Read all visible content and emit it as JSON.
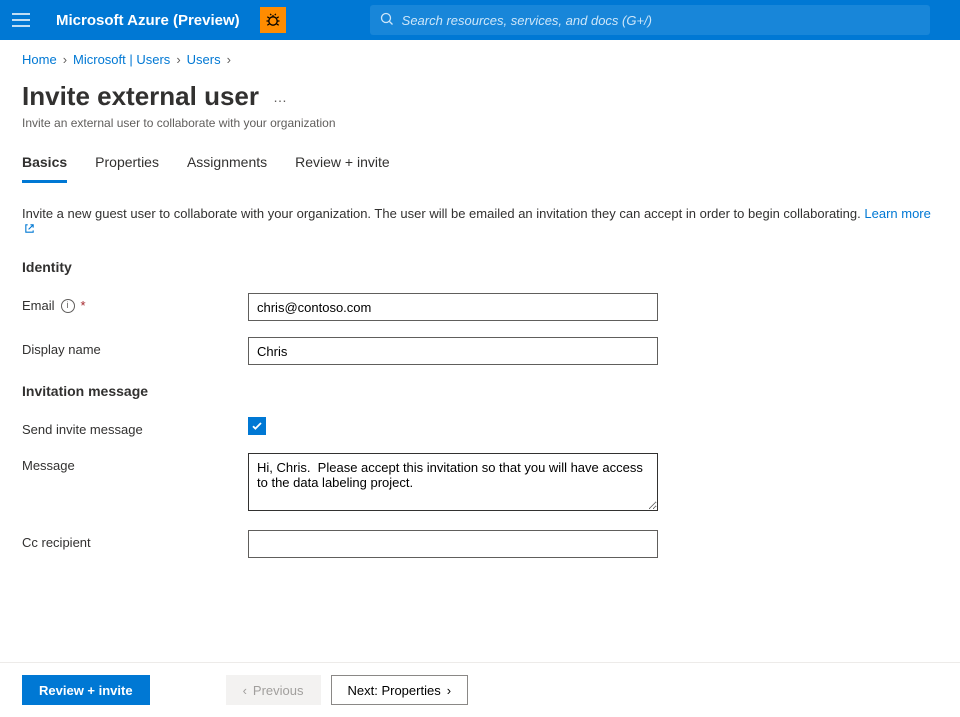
{
  "header": {
    "brand": "Microsoft Azure (Preview)",
    "search_placeholder": "Search resources, services, and docs (G+/)"
  },
  "breadcrumb": {
    "items": [
      "Home",
      "Microsoft | Users",
      "Users"
    ]
  },
  "page": {
    "title": "Invite external user",
    "subtitle": "Invite an external user to collaborate with your organization"
  },
  "tabs": [
    {
      "label": "Basics",
      "active": true
    },
    {
      "label": "Properties",
      "active": false
    },
    {
      "label": "Assignments",
      "active": false
    },
    {
      "label": "Review + invite",
      "active": false
    }
  ],
  "description": {
    "text": "Invite a new guest user to collaborate with your organization. The user will be emailed an invitation they can accept in order to begin collaborating.",
    "learn_more": "Learn more"
  },
  "sections": {
    "identity": {
      "title": "Identity",
      "email_label": "Email",
      "email_value": "chris@contoso.com",
      "display_name_label": "Display name",
      "display_name_value": "Chris"
    },
    "invitation": {
      "title": "Invitation message",
      "send_invite_label": "Send invite message",
      "send_invite_checked": true,
      "message_label": "Message",
      "message_value": "Hi, Chris.  Please accept this invitation so that you will have access to the data labeling project.",
      "cc_label": "Cc recipient",
      "cc_value": ""
    }
  },
  "footer": {
    "review_label": "Review + invite",
    "previous_label": "Previous",
    "next_label": "Next: Properties"
  }
}
